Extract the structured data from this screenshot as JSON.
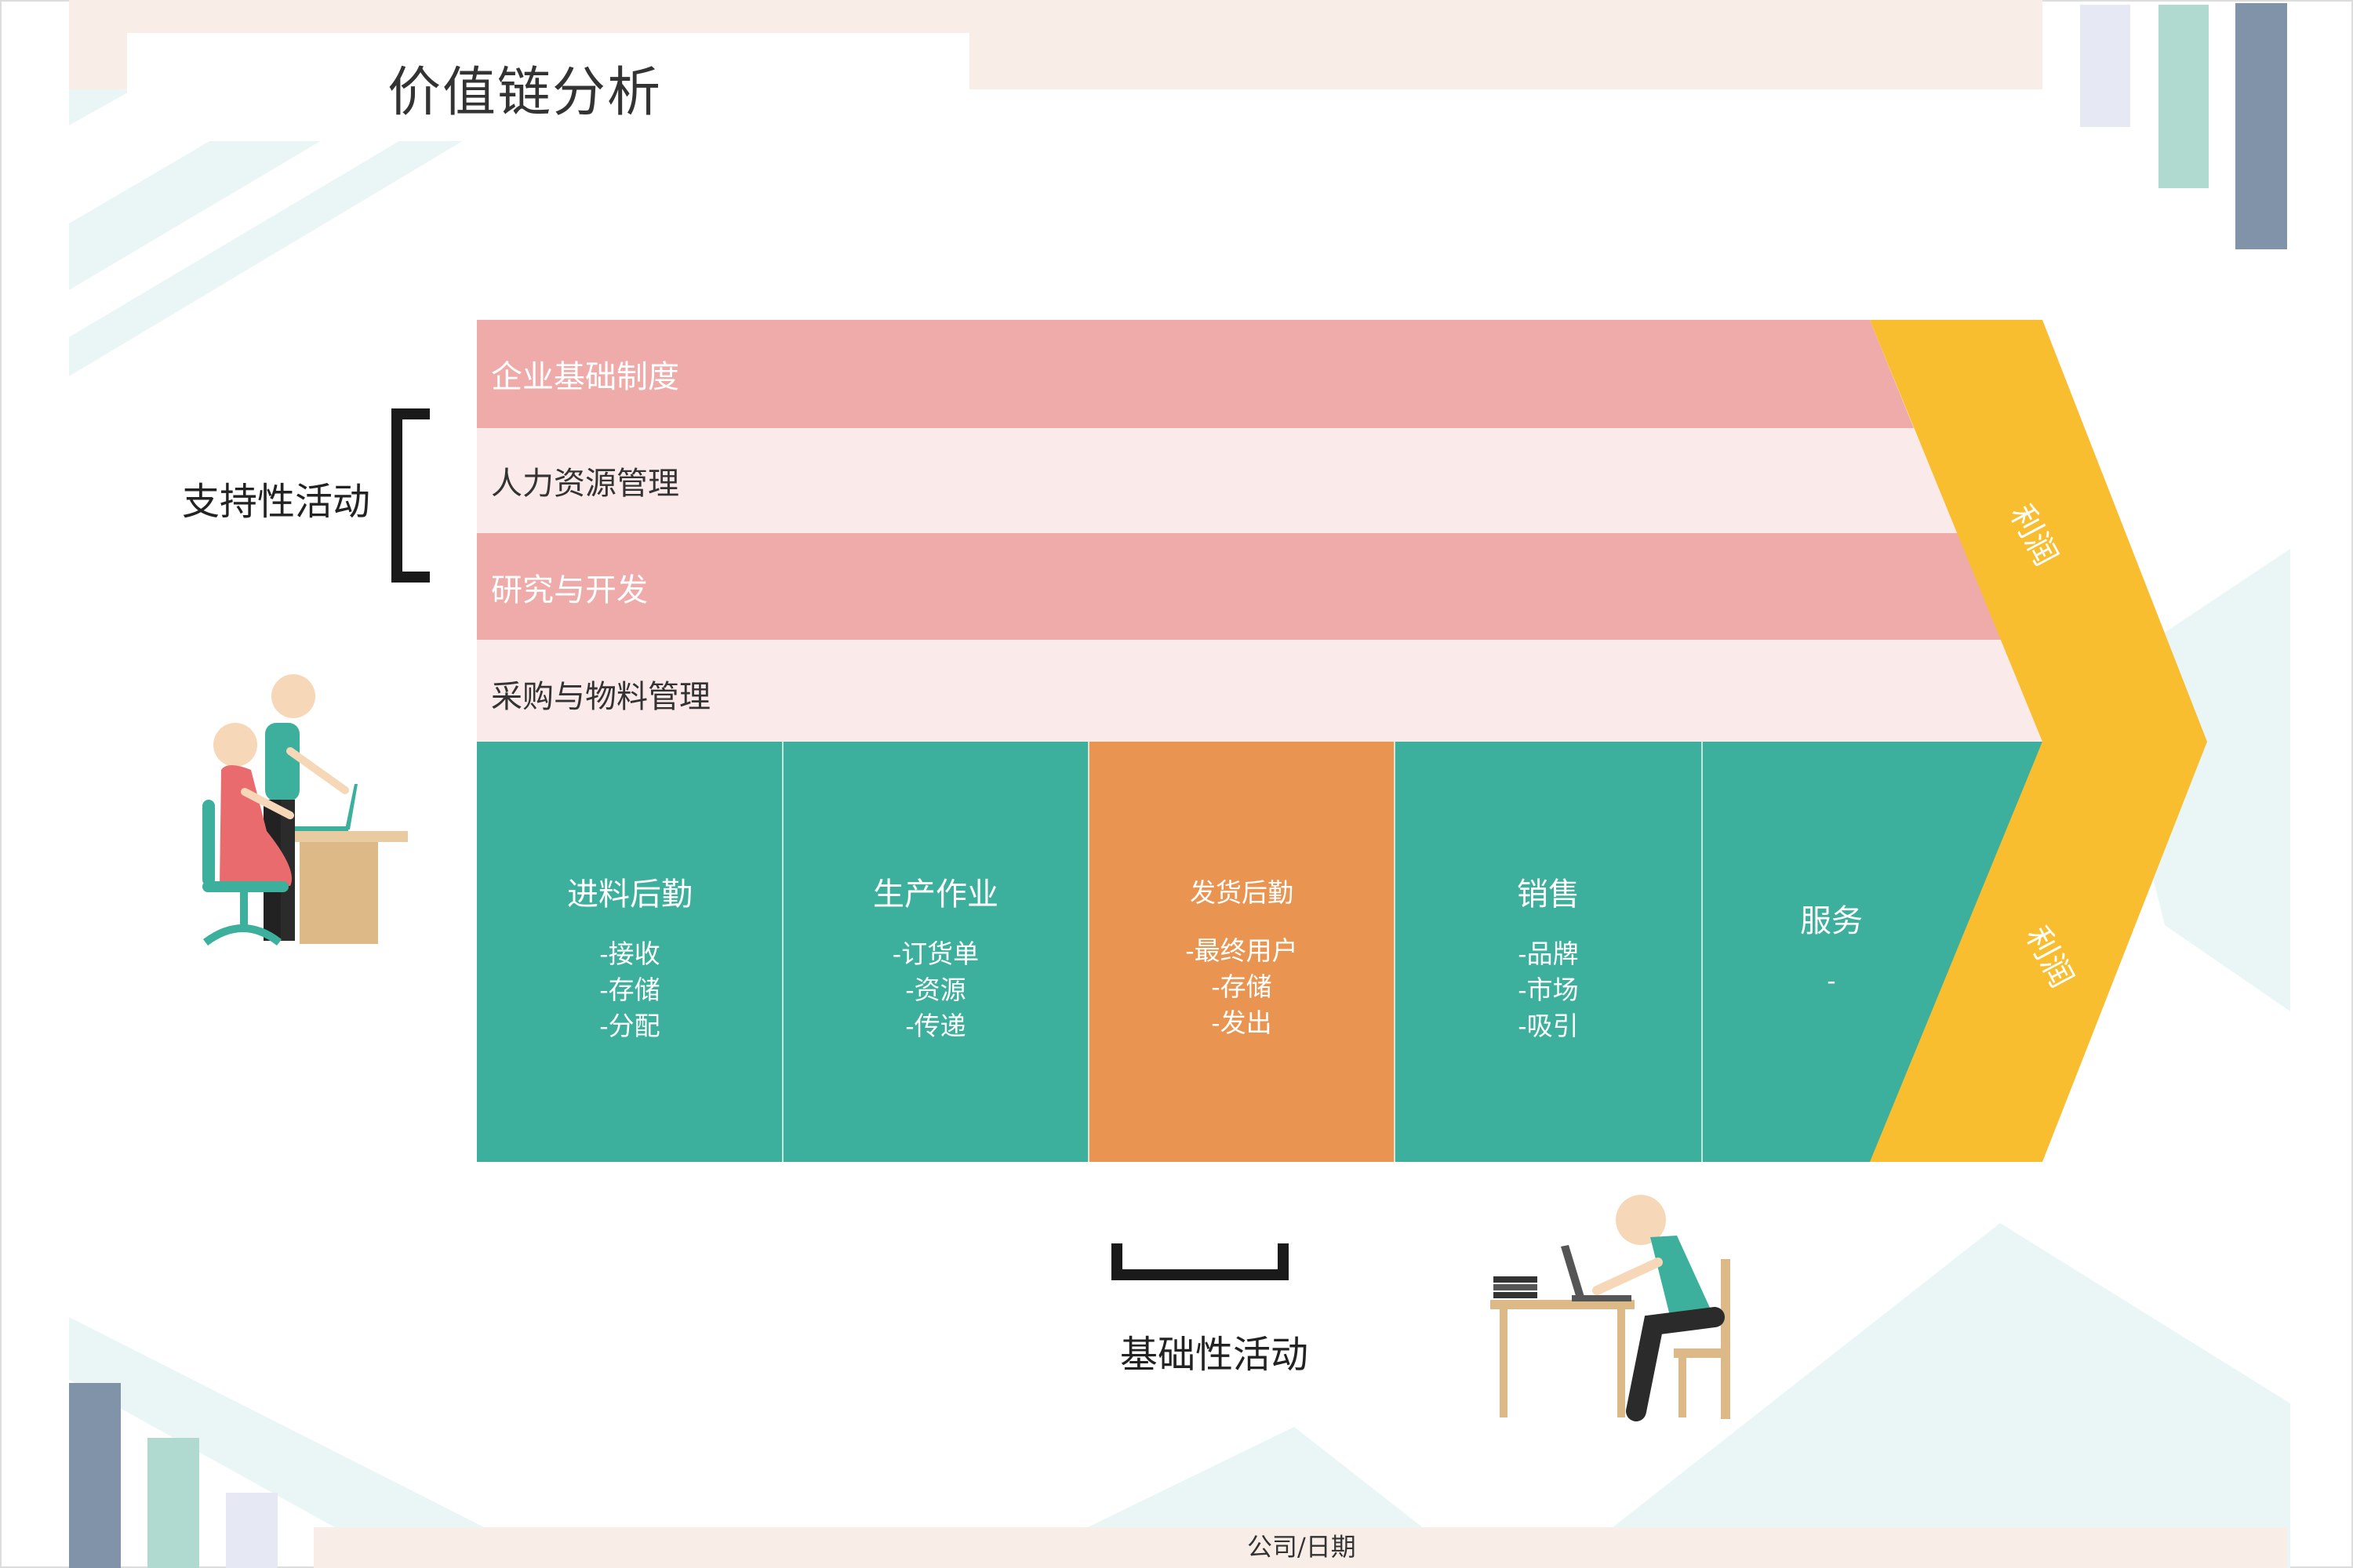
{
  "title": "价值链分析",
  "labels": {
    "support": "支持性活动",
    "primary": "基础性活动",
    "footer": "公司/日期"
  },
  "support_activities": [
    {
      "label": "企业基础制度",
      "color": "#eeabaa",
      "text_color": "#ffffff"
    },
    {
      "label": "人力资源管理",
      "color": "#faebea",
      "text_color": "#333333"
    },
    {
      "label": "研究与开发",
      "color": "#eeabaa",
      "text_color": "#ffffff"
    },
    {
      "label": "采购与物料管理",
      "color": "#faebea",
      "text_color": "#333333"
    }
  ],
  "primary_activities": [
    {
      "title": "进料后勤",
      "items": [
        "-接收",
        "-存储",
        "-分配"
      ],
      "color": "#3cb09c"
    },
    {
      "title": "生产作业",
      "items": [
        "-订货单",
        "-资源",
        "-传递"
      ],
      "color": "#3cb09c"
    },
    {
      "title": "发货后勤",
      "items": [
        "-最终用户",
        "-存储",
        "-发出"
      ],
      "color": "#ea9452"
    },
    {
      "title": "销售",
      "items": [
        "-品牌",
        "-市场",
        "-吸引"
      ],
      "color": "#3cb09c"
    },
    {
      "title": "服务",
      "items": [
        "-"
      ],
      "color": "#3cb09c"
    }
  ],
  "profit": {
    "upper": "利润",
    "lower": "利润",
    "color": "#f9bd30"
  },
  "colors": {
    "bracket": "#1a1a1a",
    "title_band": "#f9ede8",
    "light_teal": "#eaf6f6",
    "slate": "#8193a8",
    "mint": "#b0d9d0",
    "lavender": "#e6e9f3"
  }
}
